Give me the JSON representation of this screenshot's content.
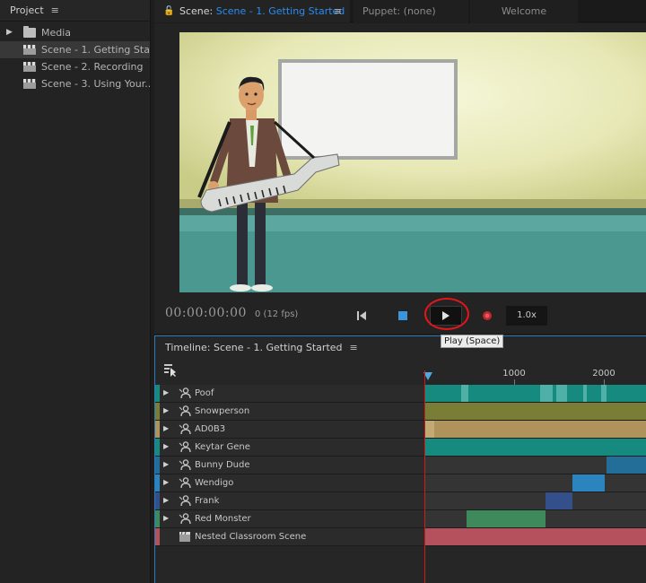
{
  "project": {
    "tab_label": "Project",
    "menu_icon": "hamburger-icon",
    "items": [
      {
        "label": "Media",
        "icon": "folder-icon"
      },
      {
        "label": "Scene - 1. Getting Sta...",
        "icon": "clapperboard-icon"
      },
      {
        "label": "Scene - 2. Recording",
        "icon": "clapperboard-icon"
      },
      {
        "label": "Scene - 3. Using Your...",
        "icon": "clapperboard-icon"
      }
    ]
  },
  "scene_panel": {
    "tabs": {
      "scene_prefix": "Scene:",
      "scene_name": "Scene - 1. Getting Started",
      "puppet": "Puppet: (none)",
      "welcome": "Welcome"
    },
    "accent_color": "#2d8ceb",
    "timecode": "00:00:00:00",
    "fps": "0 (12 fps)",
    "speed": "1.0x",
    "tooltip": "Play (Space)"
  },
  "timeline": {
    "title": "Timeline: Scene - 1. Getting Started",
    "ruler_labels": [
      "1000",
      "2000"
    ],
    "tracks": [
      {
        "name": "Poof",
        "color": "#178a80",
        "expandable": true
      },
      {
        "name": "Snowperson",
        "color": "#7a7d35",
        "expandable": true
      },
      {
        "name": "AD0B3",
        "color": "#b0935a",
        "expandable": true
      },
      {
        "name": "Keytar Gene",
        "color": "#178a80",
        "expandable": true
      },
      {
        "name": "Bunny Dude",
        "color": "#236e99",
        "expandable": true
      },
      {
        "name": "Wendigo",
        "color": "#2b84bd",
        "expandable": true
      },
      {
        "name": "Frank",
        "color": "#34508a",
        "expandable": true
      },
      {
        "name": "Red Monster",
        "color": "#3e8a5d",
        "expandable": true
      },
      {
        "name": "Nested Classroom Scene",
        "color": "#b5515c",
        "expandable": false
      }
    ]
  }
}
